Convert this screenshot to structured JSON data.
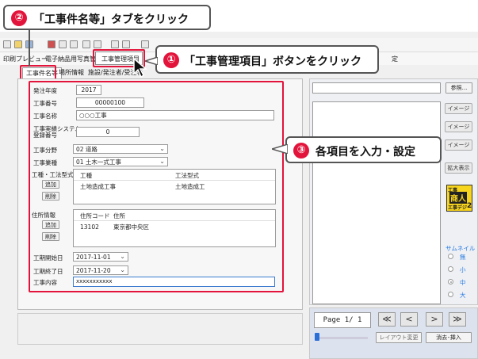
{
  "callouts": {
    "step2": {
      "number": "②",
      "text": "「工事件名等」タブをクリック"
    },
    "step1": {
      "number": "①",
      "text": "「工事管理項目」ボタンをクリック"
    },
    "step3": {
      "number": "③",
      "text": "各項目を入力・設定"
    }
  },
  "menu": {
    "print_preview": "印刷プレビュー",
    "evidence_management": "電子納品用写真管理",
    "construction_management_item": "工事管理項目",
    "settings_tail": "定"
  },
  "tabs": [
    {
      "label": "工事件名等"
    },
    {
      "label": "場所情報"
    },
    {
      "label": "施設/発注者/受注者"
    }
  ],
  "form": {
    "order_year_label": "発注年度",
    "order_year_value": "2017",
    "project_no_label": "工事番号",
    "project_no_value": "00000100",
    "project_name_label": "工事名称",
    "project_name_value": "○○○工事",
    "registration_label_1": "工事実績システム",
    "registration_label_2": "登録番号",
    "registration_value": "0",
    "field_label": "工事分野",
    "field_value": "02 道路",
    "industry_label": "工事業種",
    "industry_value": "01 土木一式工事",
    "type_label": "工種・工法型式",
    "type_table": {
      "headers": [
        "工種",
        "工法型式"
      ],
      "rows": [
        [
          "土地造成工事",
          "土地造成工"
        ]
      ]
    },
    "add_label": "追加",
    "delete_label": "削除",
    "address_label": "住所情報",
    "address_table": {
      "headers": [
        "住所コード",
        "住所"
      ],
      "rows": [
        [
          "13102",
          "東京都中央区"
        ]
      ]
    },
    "start_label": "工期開始日",
    "start_value": "2017-11-01",
    "end_label": "工期終了日",
    "end_value": "2017-11-20",
    "content_label": "工事内容",
    "content_value": "xxxxxxxxxxx"
  },
  "right_panel": {
    "ref_button": "参照...",
    "image_buttons": [
      "イメージ",
      "イメージ",
      "イメージ"
    ],
    "enlarge_button": "拡大表示",
    "logo_top": "工事",
    "logo_mid": "商人",
    "logo_bottom": "エ事デジ",
    "logo_num": "2",
    "thumbnail_label": "サムネイル",
    "thumb_options": [
      "無",
      "小",
      "中",
      "大"
    ],
    "thumb_selected": "中"
  },
  "pager": {
    "page_text": "Page 1/ 1",
    "layout_button": "レイアウト変更",
    "delete_insert_button": "消去･挿入",
    "first": "≪",
    "prev": "<",
    "next": ">",
    "last": "≫"
  }
}
